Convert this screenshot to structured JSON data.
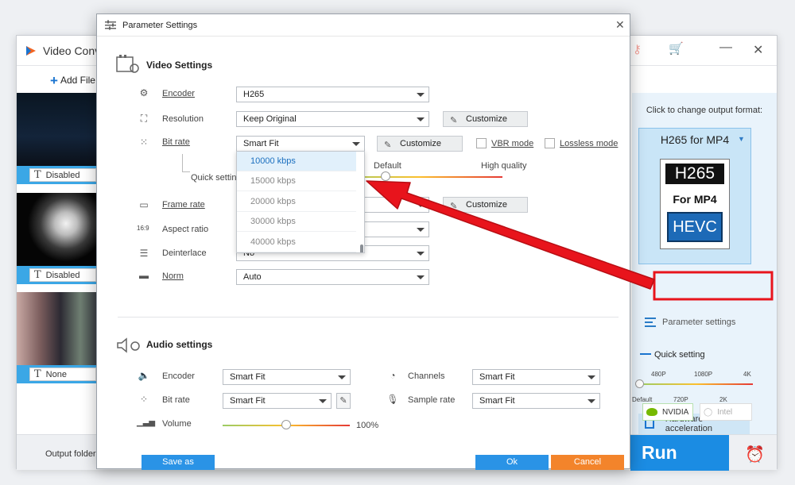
{
  "main_window": {
    "title": "Video Conv",
    "toolbar": {
      "add_files_label": "Add File"
    },
    "tasks": [
      {
        "subtitle": "Disabled"
      },
      {
        "subtitle": "Disabled"
      },
      {
        "subtitle": "None"
      }
    ],
    "right_panel": {
      "format_hint": "Click to change output format:",
      "format_name": "H265 for MP4",
      "format_image_text": {
        "line1": "H265",
        "line2": "For MP4",
        "line3": "HEVC"
      },
      "parameter_settings_label": "Parameter settings",
      "quick_setting_label": "Quick setting",
      "quick_setting_ticks_top": [
        "480P",
        "1080P",
        "4K"
      ],
      "quick_setting_ticks_bottom": [
        "Default",
        "720P",
        "2K"
      ],
      "hardware_acceleration_label": "Hardware acceleration",
      "gpu_options": [
        "NVIDIA",
        "Intel"
      ]
    },
    "bottom": {
      "output_folder_label": "Output folder:",
      "run_label": "Run"
    }
  },
  "dialog": {
    "title": "Parameter Settings",
    "video_settings": {
      "title": "Video Settings",
      "encoder": {
        "label": "Encoder",
        "value": "H265"
      },
      "resolution": {
        "label": "Resolution",
        "value": "Keep Original",
        "customize": "Customize"
      },
      "bit_rate": {
        "label": "Bit rate",
        "value": "Smart Fit",
        "customize": "Customize",
        "vbr_label": "VBR mode",
        "lossless_label": "Lossless mode",
        "dropdown_options": [
          "10000 kbps",
          "15000 kbps",
          "20000 kbps",
          "30000 kbps",
          "40000 kbps"
        ],
        "highlighted_option": "10000 kbps"
      },
      "quick_setting": {
        "label": "Quick setting",
        "default_label": "Default",
        "high_quality_label": "High quality"
      },
      "frame_rate": {
        "label": "Frame rate",
        "customize": "Customize"
      },
      "aspect_ratio": {
        "label": "Aspect ratio",
        "icon_text": "16:9"
      },
      "deinterlace": {
        "label": "Deinterlace",
        "value": "No"
      },
      "norm": {
        "label": "Norm",
        "value": "Auto"
      }
    },
    "audio_settings": {
      "title": "Audio settings",
      "encoder": {
        "label": "Encoder",
        "value": "Smart Fit"
      },
      "bit_rate": {
        "label": "Bit rate",
        "value": "Smart Fit"
      },
      "volume": {
        "label": "Volume",
        "value": "100%",
        "level_fraction": 0.5
      },
      "channels": {
        "label": "Channels",
        "value": "Smart Fit"
      },
      "sample_rate": {
        "label": "Sample rate",
        "value": "Smart Fit"
      }
    },
    "buttons": {
      "save_as": "Save as",
      "ok": "Ok",
      "cancel": "Cancel"
    }
  },
  "colors": {
    "accent_blue": "#2a93e6",
    "cancel_orange": "#f3842b",
    "annotation_red": "#e8141c"
  }
}
